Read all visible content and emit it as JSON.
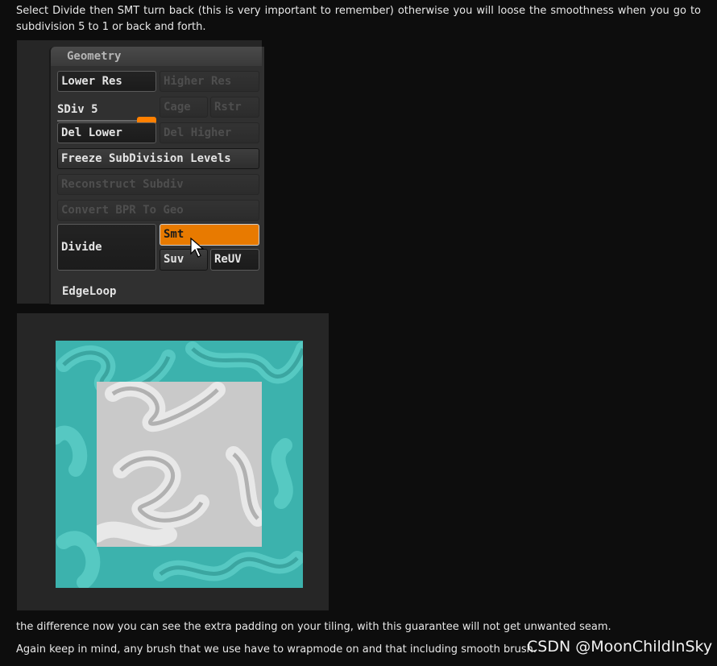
{
  "article": {
    "p1": "Select Divide then SMT turn back (this is very important to remember) otherwise you will loose the smoothness when you go to subdivision 5 to 1 or back and forth.",
    "p2": "the difference now you can see the extra padding on your tiling, with this guarantee will not get unwanted seam.",
    "p3": "Again keep in mind, any brush that we use have to wrapmode on and that including smooth brush."
  },
  "geometry_panel": {
    "title": "Geometry",
    "lower_res": "Lower Res",
    "higher_res": "Higher Res",
    "sdiv_label": "SDiv 5",
    "sdiv_level": 5,
    "cage": "Cage",
    "rstr": "Rstr",
    "del_lower": "Del Lower",
    "del_higher": "Del Higher",
    "freeze": "Freeze SubDivision Levels",
    "reconstruct": "Reconstruct Subdiv",
    "convert": "Convert BPR To Geo",
    "divide": "Divide",
    "smt": "Smt",
    "suv": "Suv",
    "reuv": "ReUV",
    "edgeloop": "EdgeLoop",
    "colors": {
      "active_orange": "#e87a00",
      "panel_bg": "#303030"
    }
  },
  "texture_preview": {
    "colors": {
      "tile": "#3cb2ad",
      "center": "#c9c9c9"
    }
  },
  "watermark": "CSDN @MoonChildInSky"
}
